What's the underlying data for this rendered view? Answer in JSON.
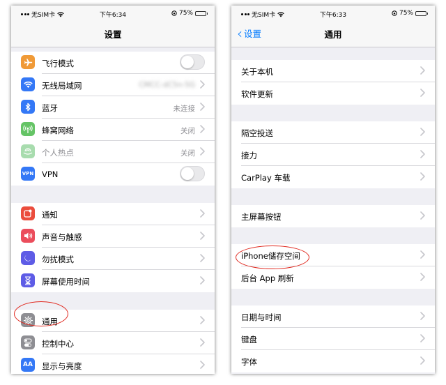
{
  "left": {
    "status": {
      "carrier": "无SIM卡",
      "time": "下午6:34",
      "battery": "75%",
      "battery_level": 0.75
    },
    "nav": {
      "title": "设置"
    },
    "groups": [
      [
        {
          "name": "airplane",
          "label": "飞行模式",
          "icon": "airplane-icon",
          "color": "#f09a37",
          "accessory": "toggle",
          "on": false
        },
        {
          "name": "wifi",
          "label": "无线局域网",
          "icon": "wifi-icon",
          "color": "#3478f6",
          "value": "CMCC-dC5n-5G",
          "blur": true,
          "accessory": "chevron"
        },
        {
          "name": "bluetooth",
          "label": "蓝牙",
          "icon": "bluetooth-icon",
          "color": "#3478f6",
          "value": "未连接",
          "accessory": "chevron"
        },
        {
          "name": "cellular",
          "label": "蜂窝网络",
          "icon": "cellular-icon",
          "color": "#65c466",
          "value": "关闭",
          "accessory": "chevron"
        },
        {
          "name": "hotspot",
          "label": "个人热点",
          "icon": "hotspot-icon",
          "color": "#a8dcae",
          "value": "关闭",
          "dim": true,
          "accessory": "chevron"
        },
        {
          "name": "vpn",
          "label": "VPN",
          "icon": "vpn-icon",
          "icon_text": "VPN",
          "color": "#3478f6",
          "accessory": "toggle",
          "on": false
        }
      ],
      [
        {
          "name": "notifications",
          "label": "通知",
          "icon": "notifications-icon",
          "color": "#eb4d3d",
          "accessory": "chevron"
        },
        {
          "name": "sounds",
          "label": "声音与触感",
          "icon": "speaker-icon",
          "color": "#eb4d5c",
          "accessory": "chevron"
        },
        {
          "name": "dnd",
          "label": "勿扰模式",
          "icon": "moon-icon",
          "color": "#5e5ce6",
          "accessory": "chevron"
        },
        {
          "name": "screentime",
          "label": "屏幕使用时间",
          "icon": "hourglass-icon",
          "color": "#5e5ce6",
          "accessory": "chevron"
        }
      ],
      [
        {
          "name": "general",
          "label": "通用",
          "icon": "gear-icon",
          "color": "#8e8e93",
          "accessory": "chevron"
        },
        {
          "name": "control-center",
          "label": "控制中心",
          "icon": "toggles-icon",
          "color": "#8e8e93",
          "accessory": "chevron"
        },
        {
          "name": "display",
          "label": "显示与亮度",
          "icon": "text-size-icon",
          "icon_text": "AA",
          "color": "#3478f6",
          "accessory": "chevron"
        }
      ]
    ]
  },
  "right": {
    "status": {
      "carrier": "无SIM卡",
      "time": "下午6:33",
      "battery": "75%",
      "battery_level": 0.75
    },
    "nav": {
      "title": "通用",
      "back": "设置"
    },
    "groups": [
      [
        {
          "name": "about",
          "label": "关于本机"
        },
        {
          "name": "software-update",
          "label": "软件更新"
        }
      ],
      [
        {
          "name": "airdrop",
          "label": "隔空投送"
        },
        {
          "name": "handoff",
          "label": "接力"
        },
        {
          "name": "carplay",
          "label": "CarPlay 车载"
        }
      ],
      [
        {
          "name": "home-button",
          "label": "主屏幕按钮"
        }
      ],
      [
        {
          "name": "iphone-storage",
          "label": "iPhone储存空间"
        },
        {
          "name": "background-refresh",
          "label": "后台 App 刷新"
        }
      ],
      [
        {
          "name": "date-time",
          "label": "日期与时间"
        },
        {
          "name": "keyboard",
          "label": "键盘"
        },
        {
          "name": "fonts",
          "label": "字体"
        }
      ]
    ]
  }
}
